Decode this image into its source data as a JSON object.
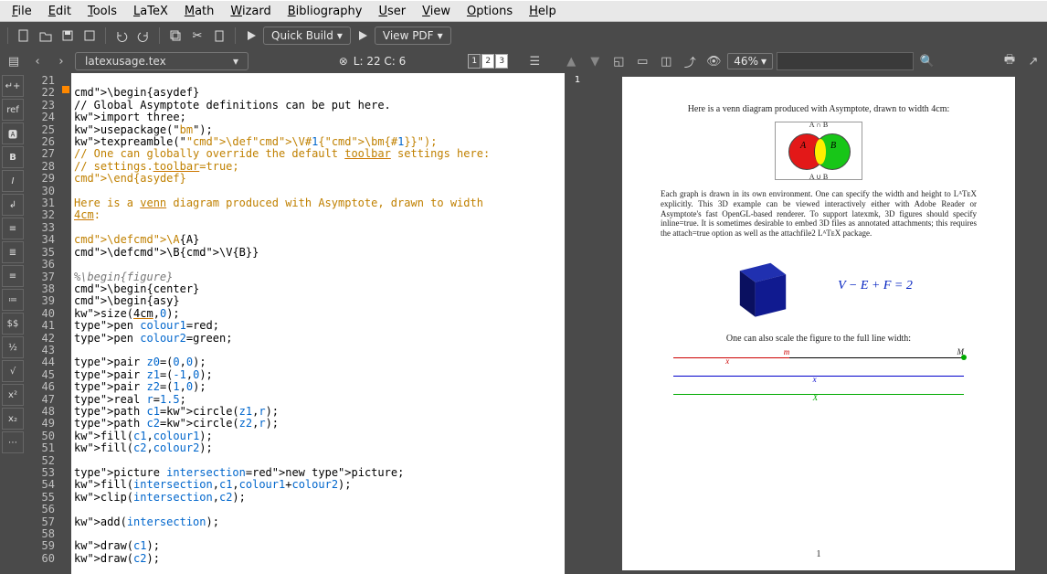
{
  "menu": {
    "file": "File",
    "edit": "Edit",
    "tools": "Tools",
    "latex": "LaTeX",
    "math": "Math",
    "wizard": "Wizard",
    "bibliography": "Bibliography",
    "user": "User",
    "view": "View",
    "options": "Options",
    "help": "Help"
  },
  "toolbar": {
    "quick_build": "Quick Build",
    "view_pdf": "View PDF"
  },
  "file_tab": "latexusage.tex",
  "cursor": "L: 22 C: 6",
  "pages": [
    "1",
    "2",
    "3"
  ],
  "zoom": "46%",
  "preview_page_marker": "1",
  "code": {
    "first_line": 21,
    "lines": [
      "",
      "\\begin{asydef}",
      "// Global Asymptote definitions can be put here.",
      "import three;",
      "usepackage(\"bm\");",
      "texpreamble(\"\\def\\V#1{\\bm{#1}}\");",
      "// One can globally override the default toolbar settings here:",
      "// settings.toolbar=true;",
      "\\end{asydef}",
      "",
      "Here is a venn diagram produced with Asymptote, drawn to width",
      "4cm:",
      "",
      "\\def\\A{A}",
      "\\def\\B{\\V{B}}",
      "",
      "%\\begin{figure}",
      "\\begin{center}",
      "\\begin{asy}",
      "size(4cm,0);",
      "pen colour1=red;",
      "pen colour2=green;",
      "",
      "pair z0=(0,0);",
      "pair z1=(-1,0);",
      "pair z2=(1,0);",
      "real r=1.5;",
      "path c1=circle(z1,r);",
      "path c2=circle(z2,r);",
      "fill(c1,colour1);",
      "fill(c2,colour2);",
      "",
      "picture intersection=new picture;",
      "fill(intersection,c1,colour1+colour2);",
      "clip(intersection,c2);",
      "",
      "add(intersection);",
      "",
      "draw(c1);",
      "draw(c2);"
    ]
  },
  "preview": {
    "header": "Here is a venn diagram produced with Asymptote, drawn to width 4cm:",
    "venn_top": "A ∩ B",
    "venn_bot": "A ∪ B",
    "venn_A": "A",
    "venn_B": "B",
    "para": "Each graph is drawn in its own environment. One can specify the width and height to LᴬTᴇX explicitly. This 3D example can be viewed interactively either with Adobe Reader or Asymptote's fast OpenGL-based renderer. To support latexmk, 3D figures should specify inline=true. It is sometimes desirable to embed 3D files as annotated attachments; this requires the attach=true option as well as the attachfile2 LᴬTᴇX package.",
    "formula": "V − E + F = 2",
    "scale_caption": "One can also scale the figure to the full line width:",
    "labels": {
      "m_small": "m",
      "M_big": "M",
      "x": "x",
      "X_big": "X"
    },
    "page_num": "1"
  }
}
